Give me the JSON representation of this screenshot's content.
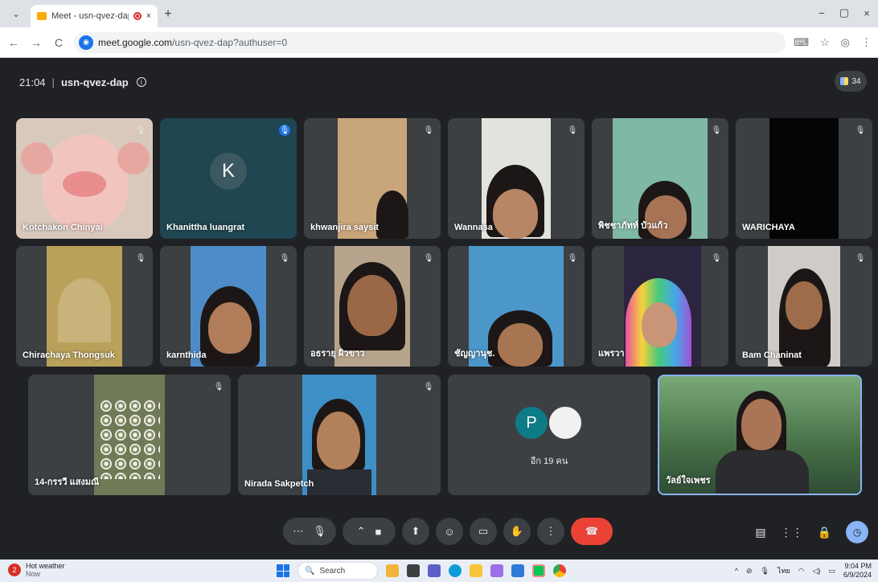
{
  "browser": {
    "tab_title": "Meet - usn-qvez-dap",
    "tab_close": "×",
    "new_tab": "+",
    "url_host": "meet.google.com",
    "url_path": "/usn-qvez-dap?authuser=0",
    "back": "←",
    "forward": "→",
    "reload": "C",
    "win_min": "−",
    "win_max": "▢",
    "win_close": "×"
  },
  "meeting": {
    "time": "21:04",
    "code": "usn-qvez-dap",
    "participant_count": "34"
  },
  "tiles": [
    {
      "name": "Kotchakon Chinyai"
    },
    {
      "name": "Khanittha luangrat",
      "initial": "K"
    },
    {
      "name": "khwanjira saysit"
    },
    {
      "name": "Wannasa"
    },
    {
      "name": "พิชชาภัทท์ บัวแก้ว"
    },
    {
      "name": "WARICHAYA"
    },
    {
      "name": "Chirachaya Thongsuk"
    },
    {
      "name": "karnthida"
    },
    {
      "name": "อธรายุ ผิวขาว"
    },
    {
      "name": "ชัญญานุช."
    },
    {
      "name": "แพรวา"
    },
    {
      "name": "Bam Chaninat"
    },
    {
      "name": "14-กรรวี แสงมณี"
    },
    {
      "name": "Nirada Sakpetch"
    },
    {
      "name": "วัลย์ใจเพชร"
    }
  ],
  "others": {
    "initial": "P",
    "label": "อีก 19 คน"
  },
  "taskbar": {
    "weather_title": "Hot weather",
    "weather_sub": "Now",
    "weather_badge": "2",
    "search_label": "Search",
    "lang": "ไทย",
    "time": "9:04 PM",
    "date": "6/9/2024"
  }
}
